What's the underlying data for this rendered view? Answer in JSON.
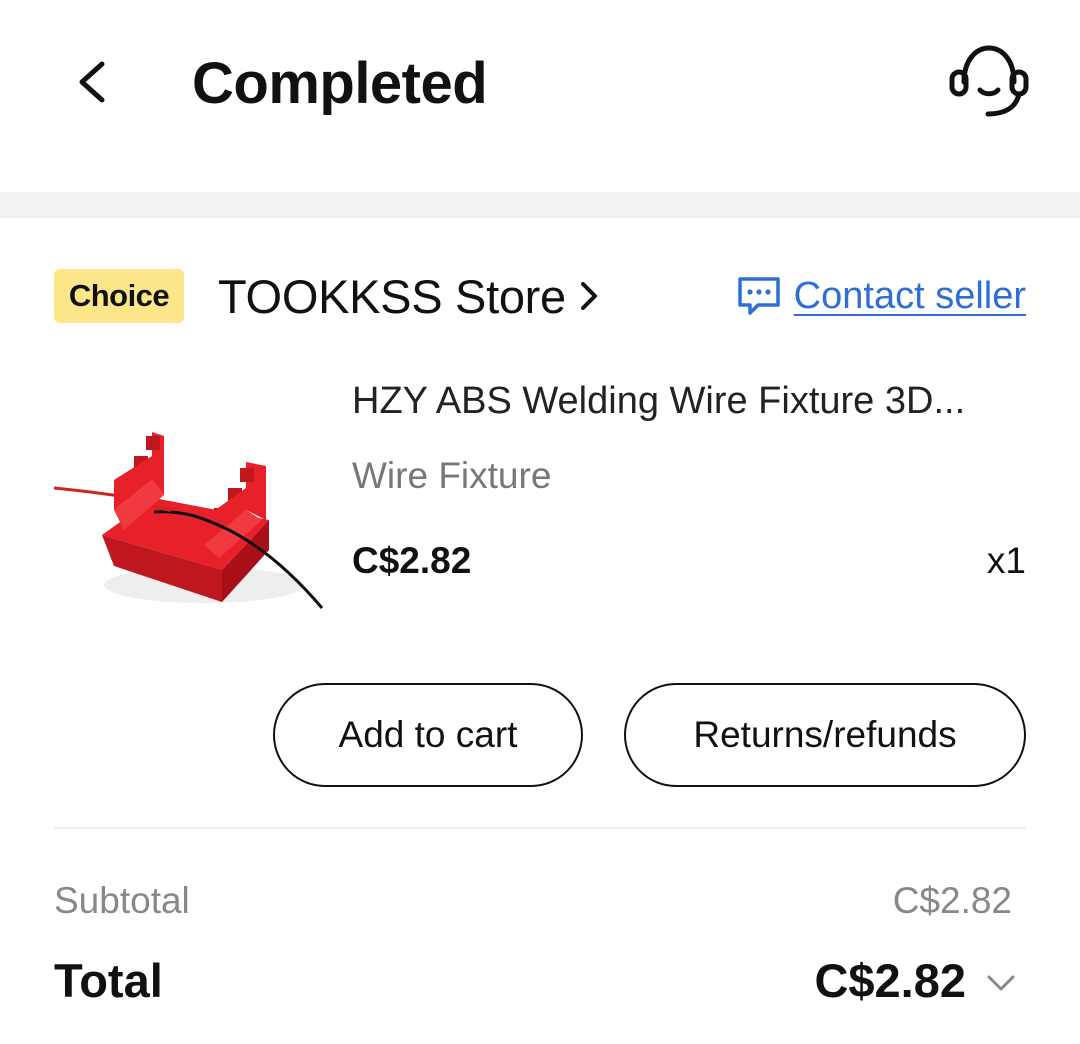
{
  "header": {
    "title": "Completed",
    "back_icon": "chevron-left-icon",
    "support_icon": "headset-icon"
  },
  "store": {
    "badge": "Choice",
    "name": "TOOKKSS Store",
    "contact_label": "Contact seller"
  },
  "product": {
    "title": "HZY ABS Welding Wire Fixture 3D...",
    "variant": "Wire Fixture",
    "price": "C$2.82",
    "quantity": "x1"
  },
  "actions": {
    "add_to_cart": "Add to cart",
    "returns": "Returns/refunds"
  },
  "summary": {
    "subtotal_label": "Subtotal",
    "subtotal_value": "C$2.82",
    "total_label": "Total",
    "total_value": "C$2.82"
  },
  "colors": {
    "accent_blue": "#2f6ed8",
    "choice_badge": "#fde68a",
    "product_red": "#e8202a"
  }
}
